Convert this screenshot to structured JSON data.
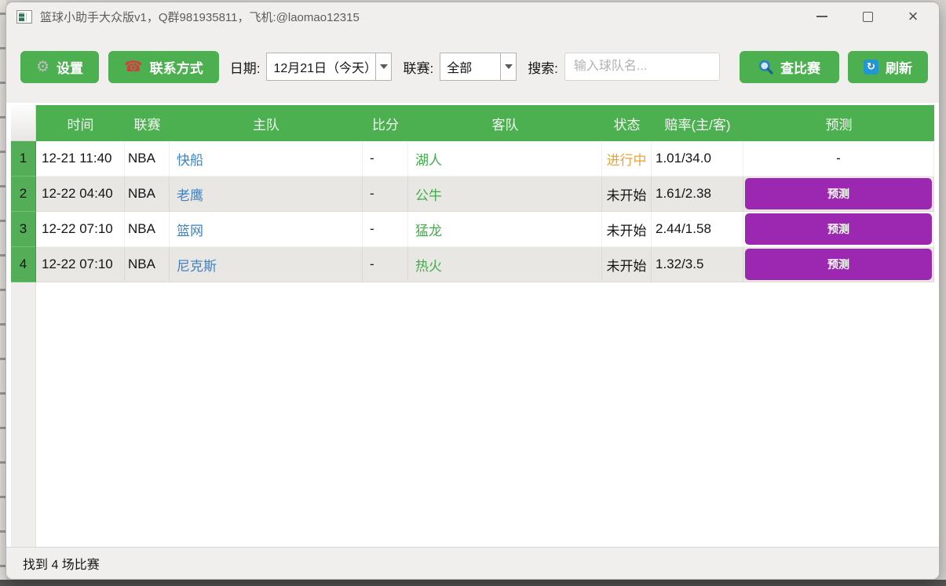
{
  "window": {
    "title": "篮球小助手大众版v1，Q群981935811，飞机:@laomao12315",
    "controls": {
      "minimize": "minimize",
      "maximize": "maximize",
      "close": "×"
    }
  },
  "toolbar": {
    "settings_label": "设置",
    "contact_label": "联系方式",
    "date_label": "日期:",
    "date_value": "12月21日（今天）",
    "league_label": "联赛:",
    "league_value": "全部",
    "search_label": "搜索:",
    "search_placeholder": "输入球队名...",
    "find_label": "查比赛",
    "refresh_label": "刷新"
  },
  "icons": {
    "settings": "gear-icon",
    "contact": "phone-icon",
    "find": "search-icon",
    "refresh": "refresh-icon",
    "combo": "chevron-down-icon",
    "gear_glyph": "⚙",
    "phone_glyph": "☎",
    "refresh_glyph": "↻"
  },
  "table": {
    "headers": [
      "时间",
      "联赛",
      "主队",
      "比分",
      "客队",
      "状态",
      "赔率(主/客)",
      "预测"
    ],
    "rows": [
      {
        "num": "1",
        "time": "12-21 11:40",
        "league": "NBA",
        "home": "快船",
        "score": "-",
        "away": "湖人",
        "status": "进行中",
        "status_class": "status-live",
        "odds": "1.01/34.0",
        "prediction": "-",
        "has_button": false
      },
      {
        "num": "2",
        "time": "12-22 04:40",
        "league": "NBA",
        "home": "老鹰",
        "score": "-",
        "away": "公牛",
        "status": "未开始",
        "status_class": "",
        "odds": "1.61/2.38",
        "prediction": "预测",
        "has_button": true
      },
      {
        "num": "3",
        "time": "12-22 07:10",
        "league": "NBA",
        "home": "篮网",
        "score": "-",
        "away": "猛龙",
        "status": "未开始",
        "status_class": "",
        "odds": "2.44/1.58",
        "prediction": "预测",
        "has_button": true
      },
      {
        "num": "4",
        "time": "12-22 07:10",
        "league": "NBA",
        "home": "尼克斯",
        "score": "-",
        "away": "热火",
        "status": "未开始",
        "status_class": "",
        "odds": "1.32/3.5",
        "prediction": "预测",
        "has_button": true
      }
    ]
  },
  "statusbar": {
    "text": "找到 4 场比赛"
  },
  "colors": {
    "accent_green": "#4caf50",
    "predict_purple": "#9c27b0",
    "status_live_orange": "#e8a33d",
    "home_team_blue": "#3f82c4",
    "away_team_green": "#3fae49",
    "chrome_gray": "#f1efed"
  }
}
